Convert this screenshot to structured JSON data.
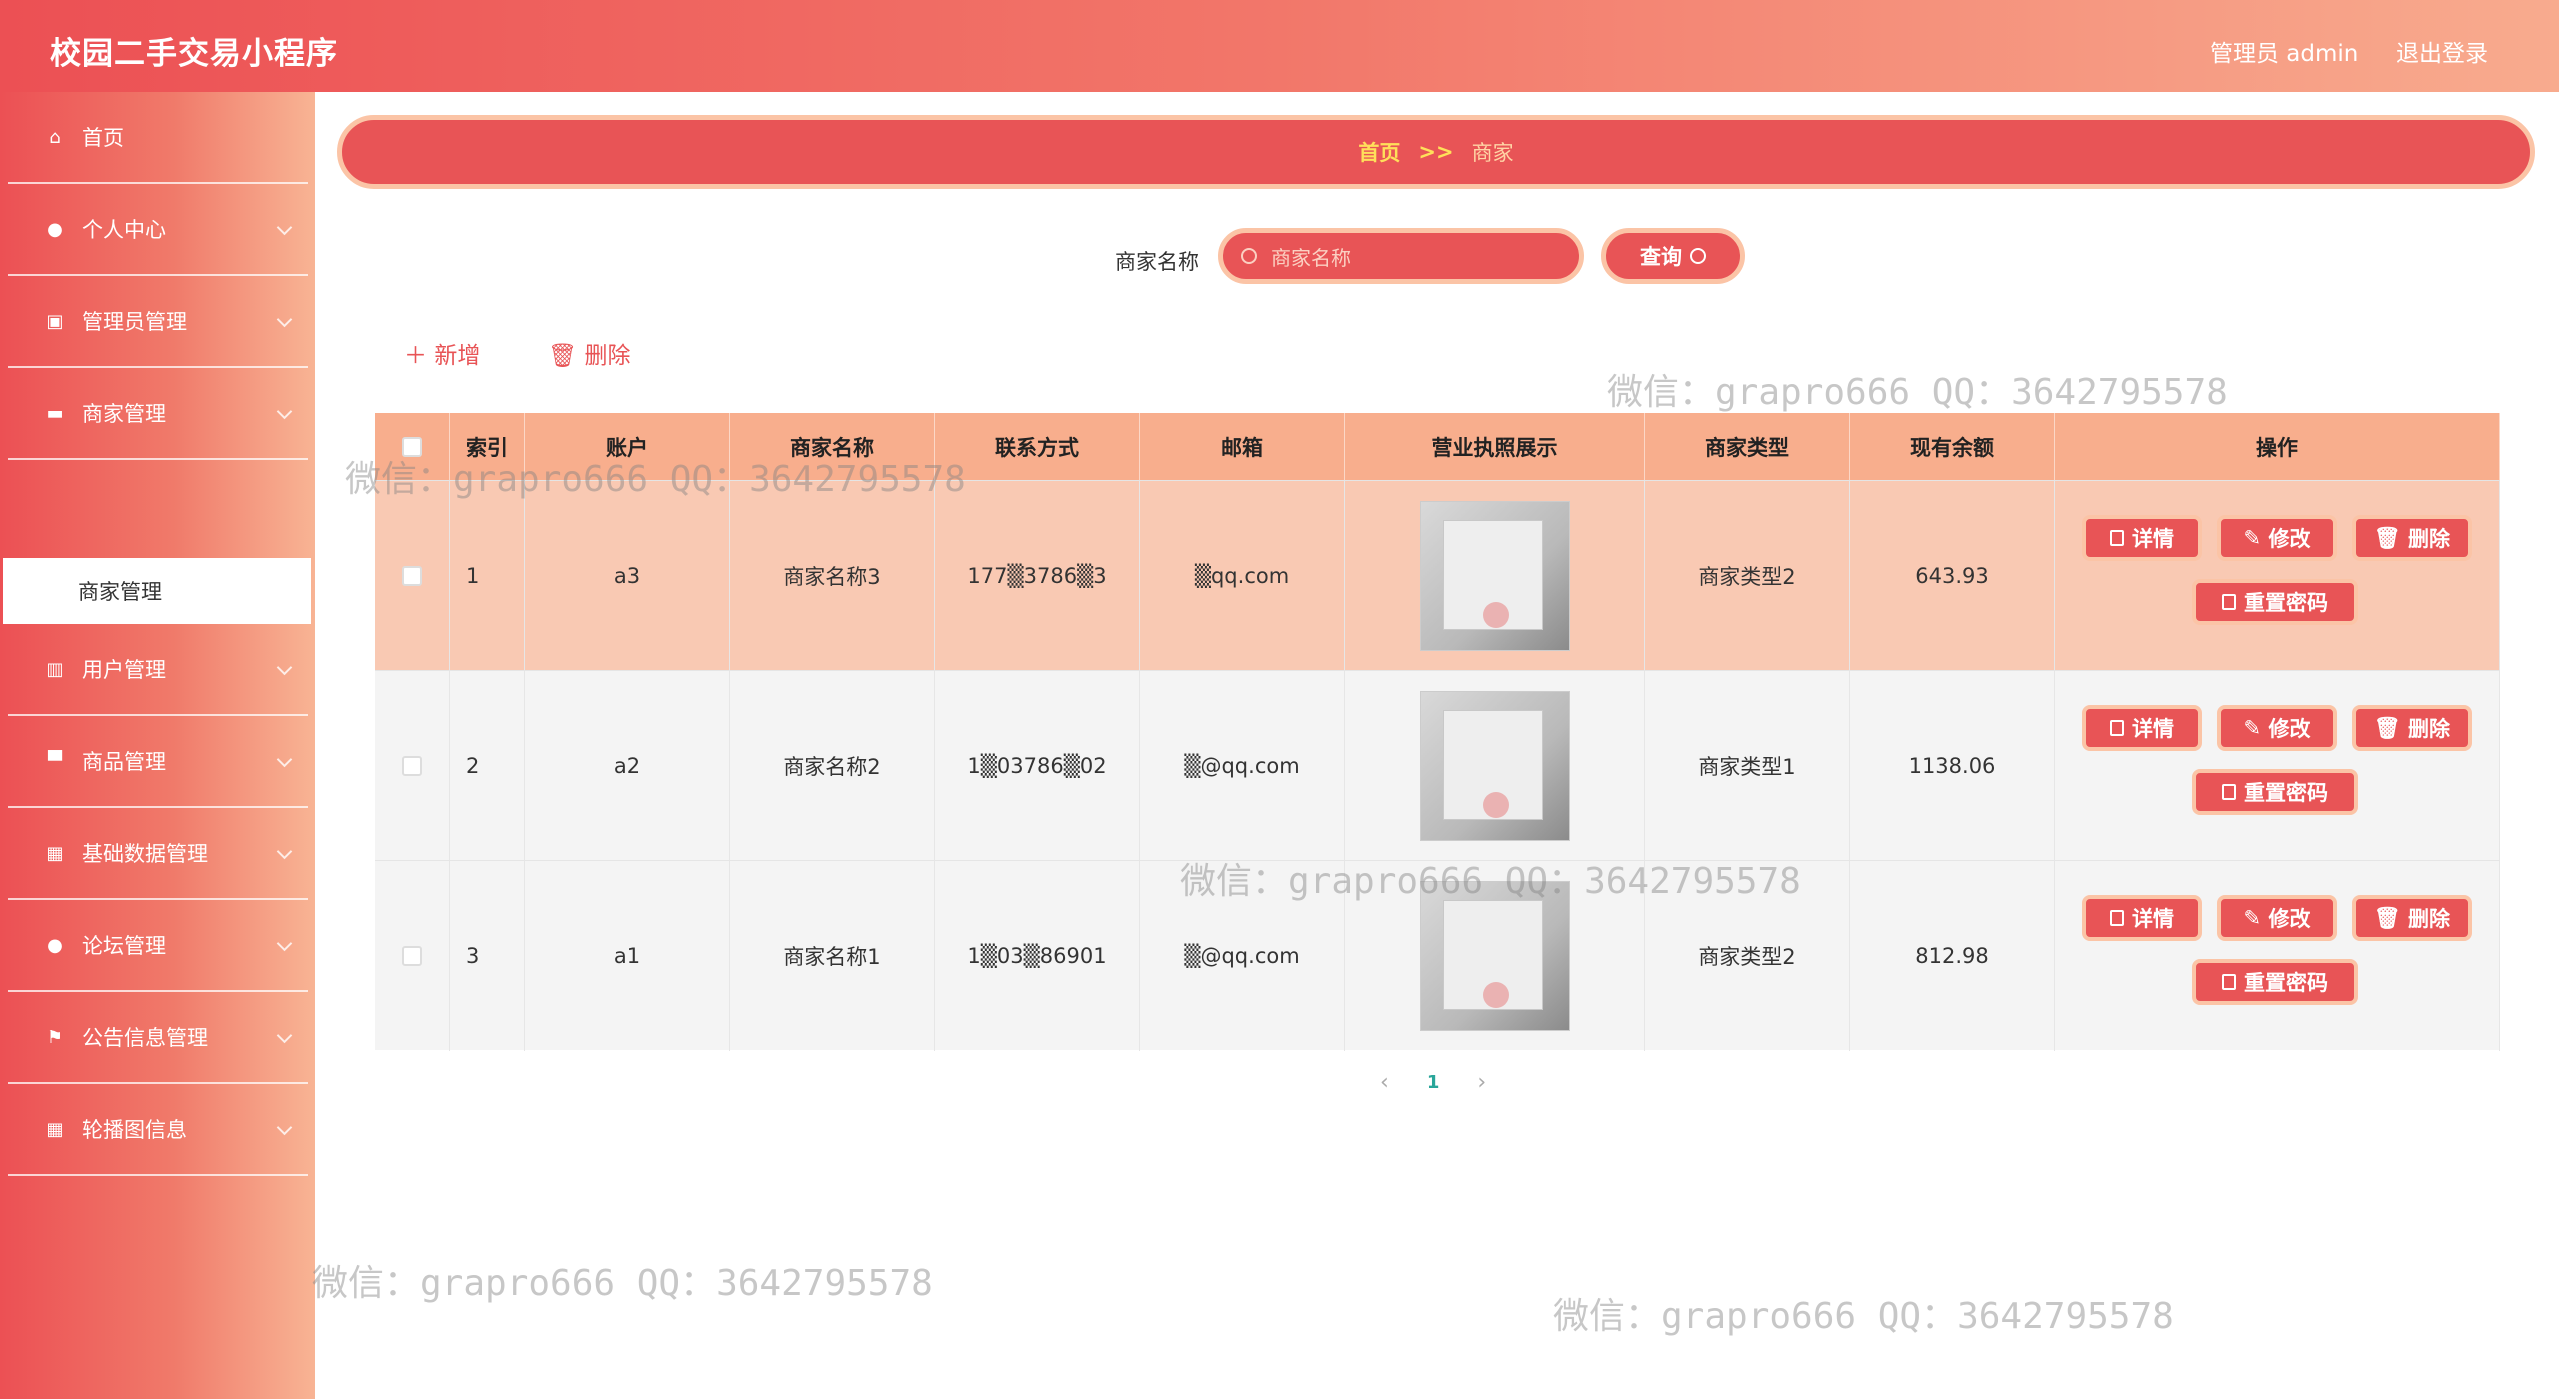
{
  "header": {
    "title": "校园二手交易小程序",
    "user": "管理员 admin",
    "logout": "退出登录"
  },
  "sidebar": {
    "items": [
      {
        "label": "首页",
        "icon": "home-icon"
      },
      {
        "label": "个人中心",
        "icon": "user-icon"
      },
      {
        "label": "管理员管理",
        "icon": "clipboard-icon"
      },
      {
        "label": "商家管理",
        "icon": "chat-icon"
      },
      {
        "label": "用户管理",
        "icon": "book-icon"
      },
      {
        "label": "商品管理",
        "icon": "box-icon"
      },
      {
        "label": "基础数据管理",
        "icon": "grid-icon"
      },
      {
        "label": "论坛管理",
        "icon": "bulb-icon"
      },
      {
        "label": "公告信息管理",
        "icon": "flag-icon"
      },
      {
        "label": "轮播图信息",
        "icon": "grid-icon"
      }
    ],
    "active_sub": "商家管理"
  },
  "breadcrumb": {
    "home": "首页",
    "sep": ">>",
    "current": "商家"
  },
  "search": {
    "label": "商家名称",
    "placeholder": "商家名称",
    "button": "查询"
  },
  "actions": {
    "add": "新增",
    "delete": "删除"
  },
  "table": {
    "headers": [
      "索引",
      "账户",
      "商家名称",
      "联系方式",
      "邮箱",
      "营业执照展示",
      "商家类型",
      "现有余额",
      "操作"
    ],
    "rows": [
      {
        "index": "1",
        "account": "a3",
        "name": "商家名称3",
        "phone": "177▒3786▒3",
        "email": "▒qq.com",
        "type": "商家类型2",
        "balance": "643.93"
      },
      {
        "index": "2",
        "account": "a2",
        "name": "商家名称2",
        "phone": "1▒03786▒02",
        "email": "▒@qq.com",
        "type": "商家类型1",
        "balance": "1138.06"
      },
      {
        "index": "3",
        "account": "a1",
        "name": "商家名称1",
        "phone": "1▒03▒86901",
        "email": "▒@qq.com",
        "type": "商家类型2",
        "balance": "812.98"
      }
    ],
    "row_buttons": {
      "detail": "详情",
      "edit": "修改",
      "delete": "删除",
      "reset": "重置密码"
    }
  },
  "pagination": {
    "prev": "‹",
    "page": "1",
    "next": "›"
  },
  "watermark": "微信：grapro666 QQ：3642795578"
}
